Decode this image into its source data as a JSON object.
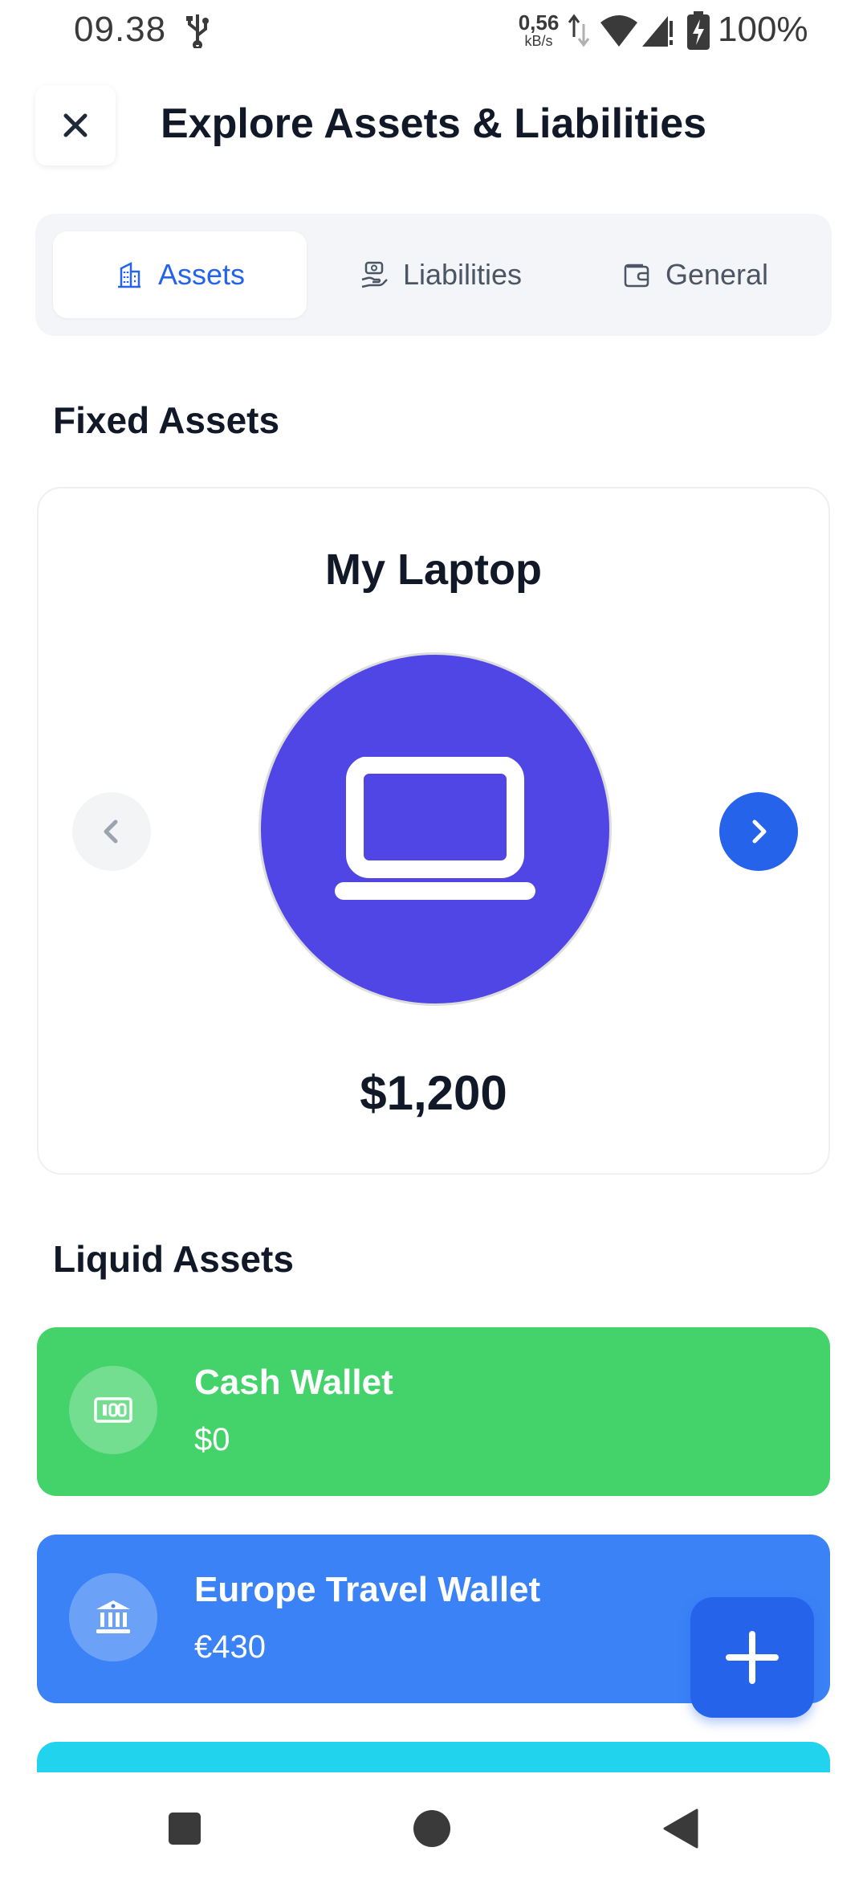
{
  "status_bar": {
    "time": "09.38",
    "net_speed_value": "0,56",
    "net_speed_unit": "kB/s",
    "battery": "100%"
  },
  "header": {
    "title": "Explore Assets & Liabilities"
  },
  "tabs": [
    {
      "label": "Assets",
      "icon": "building-icon",
      "active": true
    },
    {
      "label": "Liabilities",
      "icon": "hand-money-icon",
      "active": false
    },
    {
      "label": "General",
      "icon": "wallet-icon",
      "active": false
    }
  ],
  "fixed_assets": {
    "section_title": "Fixed Assets",
    "current": {
      "name": "My Laptop",
      "value": "$1,200",
      "icon": "laptop-icon",
      "color": "#4f46e5"
    }
  },
  "liquid_assets": {
    "section_title": "Liquid Assets",
    "items": [
      {
        "name": "Cash Wallet",
        "value": "$0",
        "icon": "cash-icon",
        "color": "#44d36a"
      },
      {
        "name": "Europe Travel Wallet",
        "value": "€430",
        "icon": "bank-icon",
        "color": "#3b82f6"
      },
      {
        "name": "",
        "value": "",
        "icon": "",
        "color": "#22d3ee"
      }
    ]
  },
  "colors": {
    "accent": "#2563eb",
    "text": "#111827"
  }
}
